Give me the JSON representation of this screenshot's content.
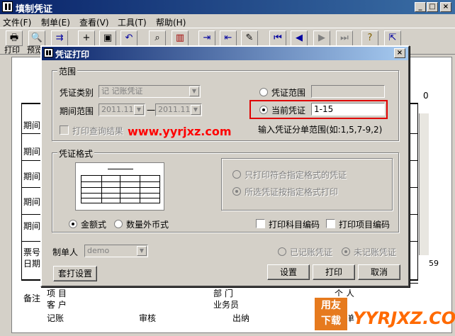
{
  "window": {
    "title": "填制凭证",
    "controls": [
      "_",
      "□",
      "×"
    ]
  },
  "menu": [
    {
      "label": "文件(F)"
    },
    {
      "label": "制单(E)"
    },
    {
      "label": "查看(V)"
    },
    {
      "label": "工具(T)"
    },
    {
      "label": "帮助(H)"
    }
  ],
  "toolbar": {
    "print_label": "打印",
    "preview_label": "预览",
    "buttons": [
      {
        "name": "print-icon",
        "glyph": "🖶"
      },
      {
        "name": "preview-icon",
        "glyph": "🔍"
      },
      {
        "name": "output-icon",
        "glyph": "⇉"
      },
      {
        "name": "add-icon",
        "glyph": "+"
      },
      {
        "name": "save-icon",
        "glyph": "▣"
      },
      {
        "name": "undo-icon",
        "glyph": "↶"
      },
      {
        "name": "find-icon",
        "glyph": "⌕"
      },
      {
        "name": "chart-icon",
        "glyph": "▥"
      },
      {
        "name": "insert-icon",
        "glyph": "⇥"
      },
      {
        "name": "delete-icon",
        "glyph": "⇤"
      },
      {
        "name": "edit-icon",
        "glyph": "✎"
      },
      {
        "name": "first-icon",
        "glyph": "⏮"
      },
      {
        "name": "prev-icon",
        "glyph": "◀"
      },
      {
        "name": "next-icon",
        "glyph": "▶"
      },
      {
        "name": "last-icon",
        "glyph": "⏭"
      },
      {
        "name": "help-icon",
        "glyph": "?"
      },
      {
        "name": "exit-icon",
        "glyph": "⇱"
      }
    ]
  },
  "background": {
    "row_labels": [
      "期间",
      "期间",
      "期间",
      "期间",
      "期间"
    ],
    "footer_label_1": "票号",
    "footer_label_2": "日期",
    "remark": "备注",
    "project": "项  目",
    "customer": "客  户",
    "department": "部  门",
    "salesman": "业务员",
    "person": "个  人",
    "bookkeeping": "记账",
    "audit": "审核",
    "cashier": "出纳",
    "maker_prefix": "制单",
    "right_zero": "0",
    "right_num": "59"
  },
  "dialog": {
    "title": "凭证打印",
    "range_group": "范围",
    "voucher_type_label": "凭证类别",
    "voucher_type_value": "记    记账凭证",
    "period_label": "期间范围",
    "period_from": "2011.11",
    "period_sep": "一",
    "period_to": "2011.11",
    "print_query_result": "打印查询结果",
    "voucher_range_label": "凭证范围",
    "current_voucher_label": "当前凭证",
    "current_voucher_value": "1-15",
    "range_hint": "输入凭证分单范围(如:1,5,7-9,2)",
    "format_group": "凭证格式",
    "only_matching_format": "只打印符合指定格式的凭证",
    "all_by_format": "所选凭证按指定格式打印",
    "amount_style": "金额式",
    "foreign_currency_style": "数量外币式",
    "print_account_code": "打印科目编码",
    "print_project_code": "打印项目编码",
    "maker_label": "制单人",
    "maker_value": "demo",
    "posted": "已记账凭证",
    "unposted": "未记账凭证",
    "template_button": "套打设置",
    "settings_button": "设置",
    "print_button": "打印",
    "cancel_button": "取消"
  },
  "overlay": {
    "watermark": "www.yyrjxz.com",
    "logo_line1": "用友",
    "logo_line2": "下载",
    "brand": "YYRJXZ.COM"
  }
}
